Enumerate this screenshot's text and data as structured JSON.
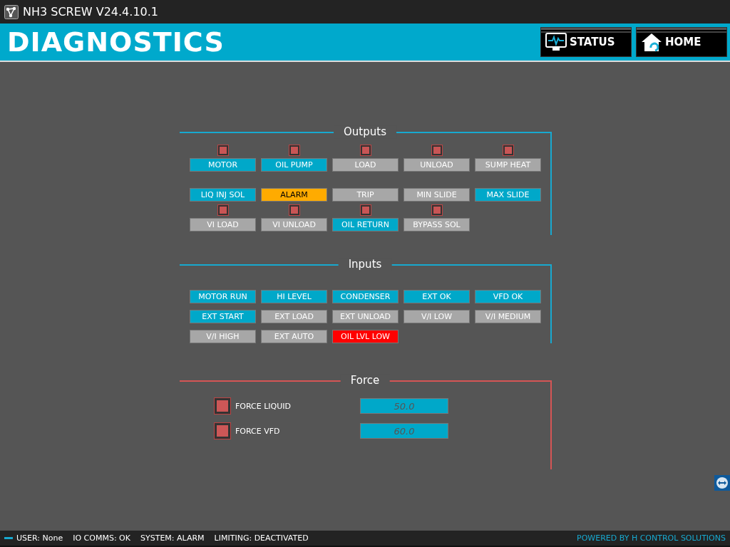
{
  "window": {
    "title": "NH3 SCREW V24.4.10.1"
  },
  "header": {
    "title": "DIAGNOSTICS",
    "buttons": [
      {
        "kind": "status",
        "label": "STATUS"
      },
      {
        "kind": "home",
        "label": "HOME"
      }
    ]
  },
  "outputs": {
    "title": "Outputs",
    "rows": [
      [
        {
          "label": "MOTOR",
          "kind": "status",
          "on": true,
          "led": true
        },
        {
          "label": "OIL PUMP",
          "kind": "status",
          "on": true,
          "led": true
        },
        {
          "label": "LOAD",
          "kind": "status",
          "on": false,
          "led": true
        },
        {
          "label": "UNLOAD",
          "kind": "status",
          "on": false,
          "led": true
        },
        {
          "label": "SUMP HEAT",
          "kind": "status",
          "on": false,
          "led": true
        }
      ],
      [
        {
          "label": "LIQ INJ SOL",
          "kind": "status",
          "on": true,
          "led": false
        },
        {
          "label": "ALARM",
          "kind": "alarm",
          "on": true,
          "led": false
        },
        {
          "label": "TRIP",
          "kind": "status",
          "on": false,
          "led": false
        },
        {
          "label": "MIN SLIDE",
          "kind": "status",
          "on": false,
          "led": false
        },
        {
          "label": "MAX SLIDE",
          "kind": "status",
          "on": true,
          "led": false
        }
      ],
      [
        {
          "label": "VI LOAD",
          "kind": "status",
          "on": false,
          "led": true
        },
        {
          "label": "VI UNLOAD",
          "kind": "status",
          "on": false,
          "led": true
        },
        {
          "label": "OIL RETURN",
          "kind": "status",
          "on": true,
          "led": true
        },
        {
          "label": "BYPASS SOL",
          "kind": "status",
          "on": false,
          "led": true
        }
      ]
    ]
  },
  "inputs": {
    "title": "Inputs",
    "items": [
      {
        "label": "MOTOR RUN",
        "kind": "status",
        "on": true
      },
      {
        "label": "HI LEVEL",
        "kind": "status",
        "on": true
      },
      {
        "label": "CONDENSER",
        "kind": "status",
        "on": true
      },
      {
        "label": "EXT OK",
        "kind": "status",
        "on": true
      },
      {
        "label": "VFD OK",
        "kind": "status",
        "on": true
      },
      {
        "label": "EXT START",
        "kind": "status",
        "on": true
      },
      {
        "label": "EXT LOAD",
        "kind": "status",
        "on": false
      },
      {
        "label": "EXT UNLOAD",
        "kind": "status",
        "on": false
      },
      {
        "label": "V/I LOW",
        "kind": "status",
        "on": false
      },
      {
        "label": "V/I MEDIUM",
        "kind": "status",
        "on": false
      },
      {
        "label": "V/I HIGH",
        "kind": "status",
        "on": false
      },
      {
        "label": "EXT AUTO",
        "kind": "status",
        "on": false
      },
      {
        "label": "OIL LVL LOW",
        "kind": "fault",
        "on": true
      }
    ]
  },
  "force": {
    "title": "Force",
    "items": [
      {
        "label": "FORCE LIQUID",
        "checked": false,
        "value": "50.0"
      },
      {
        "label": "FORCE VFD",
        "checked": false,
        "value": "60.0"
      }
    ]
  },
  "status_bar": {
    "items": [
      "USER: None",
      "IO COMMS: OK",
      "SYSTEM: ALARM",
      "LIMITING: DEACTIVATED"
    ],
    "credit": "POWERED BY H CONTROL SOLUTIONS"
  }
}
